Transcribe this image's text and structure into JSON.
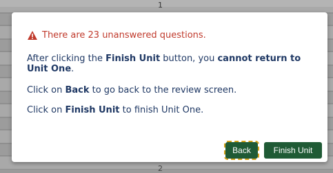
{
  "background": {
    "top_number": "1",
    "bottom_number": "2"
  },
  "dialog": {
    "warning": "There are 23 unanswered questions.",
    "warning_icon": "warning-triangle-icon",
    "warning_color": "#c0392b",
    "text_color": "#1f3864",
    "p1": {
      "a": "After clicking the ",
      "b": "Finish Unit",
      "c": " button, you ",
      "d": "cannot return to Unit One",
      "e": "."
    },
    "p2": {
      "a": "Click on ",
      "b": "Back",
      "c": " to go back to the review screen."
    },
    "p3": {
      "a": "Click on ",
      "b": "Finish Unit",
      "c": " to finish Unit One."
    },
    "buttons": {
      "back_label": "Back",
      "finish_label": "Finish Unit",
      "color": "#1f5a35",
      "focus_outline_color": "#d4a017"
    }
  }
}
